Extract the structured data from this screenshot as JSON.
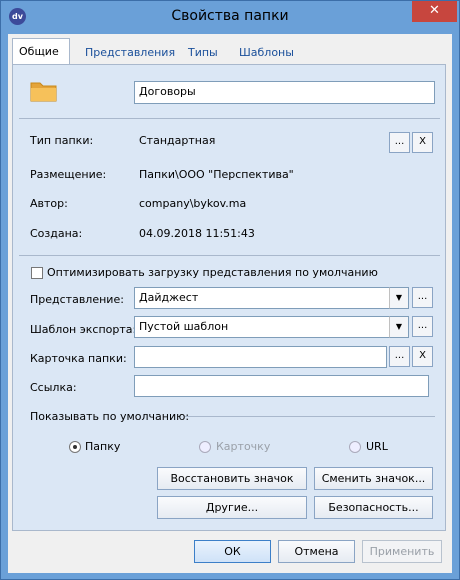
{
  "window": {
    "app_icon": "dv",
    "title": "Свойства папки",
    "close_icon": "close-icon"
  },
  "tabs": [
    {
      "label": "Общие",
      "active": true
    },
    {
      "label": "Представления",
      "active": false
    },
    {
      "label": "Типы",
      "active": false
    },
    {
      "label": "Шаблоны",
      "active": false
    }
  ],
  "general": {
    "folder_icon": "folder-icon",
    "folder_name": "Договоры",
    "folder_type_label": "Тип папки:",
    "folder_type_value": "Стандартная",
    "location_label": "Размещение:",
    "location_value": "Папки\\ООО \"Перспектива\"",
    "author_label": "Автор:",
    "author_value": "company\\bykov.ma",
    "created_label": "Создана:",
    "created_value": "04.09.2018 11:51:43",
    "browse_label": "...",
    "clear_label": "X"
  },
  "options": {
    "optimize_label": "Оптимизировать загрузку представления по умолчанию",
    "optimize_checked": false,
    "view_label": "Представление:",
    "view_value": "Дайджест",
    "export_template_label": "Шаблон экспорта:",
    "export_template_value": "Пустой шаблон",
    "folder_card_label": "Карточка папки:",
    "folder_card_value": "",
    "link_label": "Ссылка:",
    "link_value": "",
    "show_default_label": "Показывать по умолчанию:",
    "radio_folder": "Папку",
    "radio_card": "Карточку",
    "radio_url": "URL",
    "selected_radio": "Папку"
  },
  "panel_buttons": {
    "restore_icon": "Восстановить значок",
    "change_icon": "Сменить значок...",
    "other": "Другие...",
    "security": "Безопасность..."
  },
  "footer": {
    "ok": "ОК",
    "cancel": "Отмена",
    "apply": "Применить"
  },
  "colors": {
    "frame": "#6aa0d8",
    "panel": "#dbe7f5",
    "close_button": "#c7463e",
    "tab_text": "#1a4f9a"
  }
}
